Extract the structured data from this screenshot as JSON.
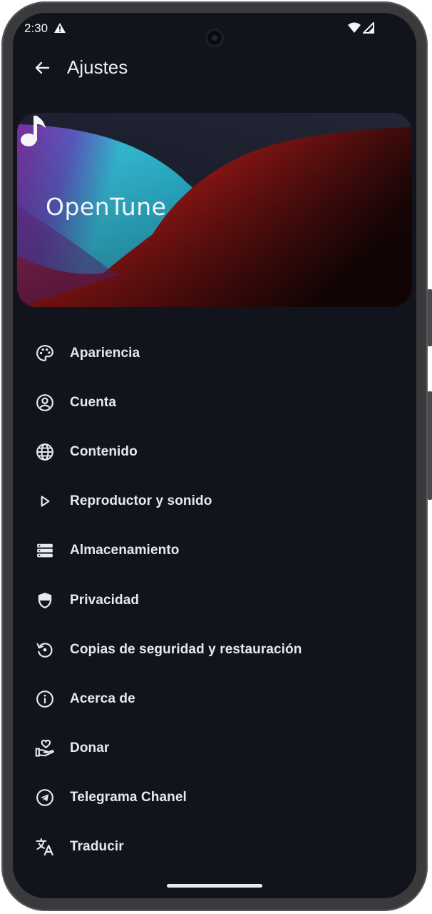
{
  "status_bar": {
    "time": "2:30"
  },
  "app_bar": {
    "title": "Ajustes"
  },
  "banner": {
    "app_name": "OpenTune"
  },
  "settings": {
    "items": [
      {
        "label": "Apariencia",
        "icon": "palette-icon"
      },
      {
        "label": "Cuenta",
        "icon": "account-circle-icon"
      },
      {
        "label": "Contenido",
        "icon": "globe-icon"
      },
      {
        "label": "Reproductor y sonido",
        "icon": "play-icon"
      },
      {
        "label": "Almacenamiento",
        "icon": "storage-icon"
      },
      {
        "label": "Privacidad",
        "icon": "shield-icon"
      },
      {
        "label": "Copias de seguridad y restauración",
        "icon": "restore-icon"
      },
      {
        "label": "Acerca de",
        "icon": "info-icon"
      },
      {
        "label": "Donar",
        "icon": "donate-hand-heart-icon"
      },
      {
        "label": "Telegrama Chanel",
        "icon": "telegram-icon"
      },
      {
        "label": "Traducir",
        "icon": "translate-icon"
      }
    ]
  },
  "colors": {
    "background": "#11141d",
    "text": "#e8e9ee",
    "banner_red": "#b01b1b",
    "banner_purple": "#7b3aa0",
    "banner_cyan": "#35c6dd"
  }
}
